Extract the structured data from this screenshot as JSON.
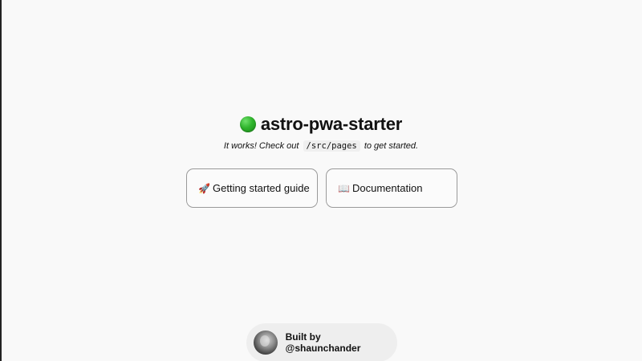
{
  "hero": {
    "title": "astro-pwa-starter",
    "subtitle_before": "It works! Check out",
    "subtitle_code": "/src/pages",
    "subtitle_after": "to get started."
  },
  "cards": [
    {
      "icon": "rocket-icon",
      "emoji": "🚀",
      "label": "Getting started guide"
    },
    {
      "icon": "book-icon",
      "emoji": "📖",
      "label": "Documentation"
    }
  ],
  "footer": {
    "credit": "Built by @shaunchander"
  },
  "colors": {
    "background": "#f9f9f9",
    "card_border": "#9a9a9a",
    "credit_pill": "#eeeeee",
    "status_dot": "#2fb42c"
  }
}
